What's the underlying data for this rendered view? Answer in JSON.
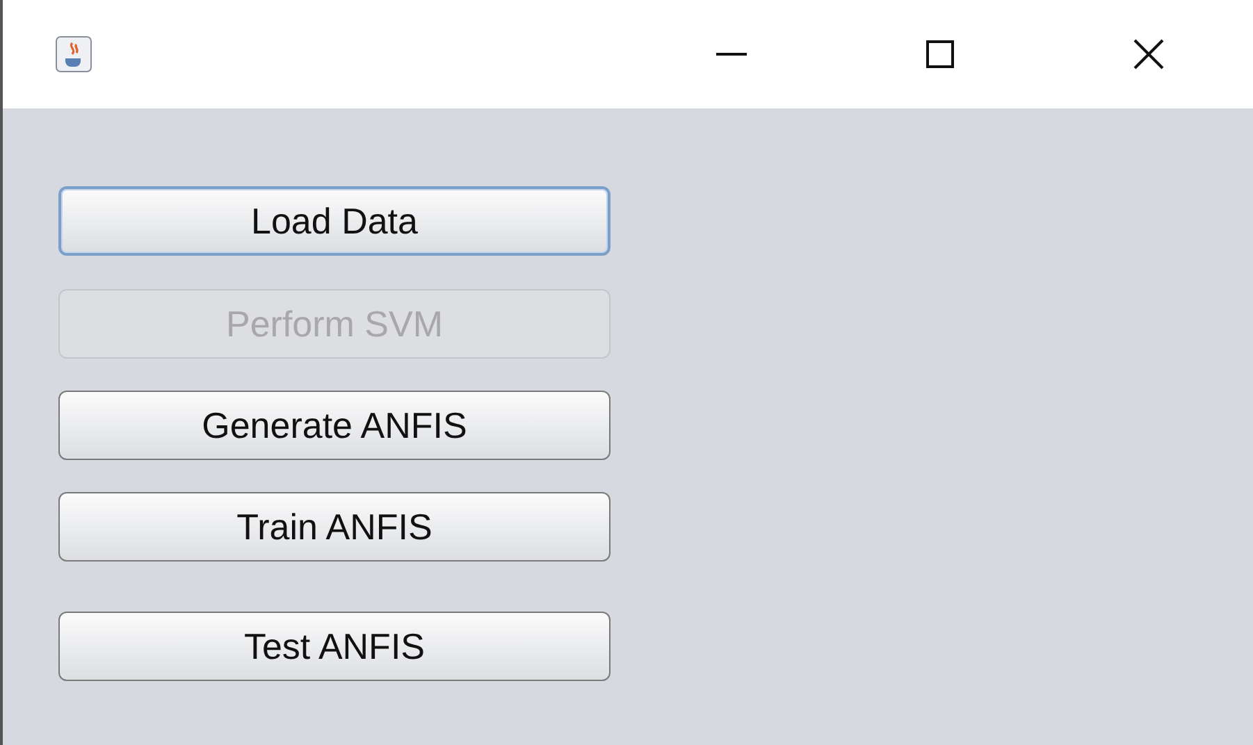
{
  "buttons": [
    {
      "label": "Load Data",
      "disabled": false,
      "focused": true
    },
    {
      "label": "Perform SVM",
      "disabled": true,
      "focused": false
    },
    {
      "label": "Generate ANFIS",
      "disabled": false,
      "focused": false
    },
    {
      "label": "Train ANFIS",
      "disabled": false,
      "focused": false
    },
    {
      "label": "Test ANFIS",
      "disabled": false,
      "focused": false
    }
  ]
}
